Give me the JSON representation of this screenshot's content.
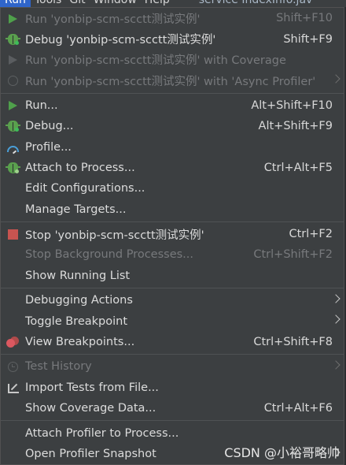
{
  "menubar": {
    "items": [
      "Run",
      "Tools",
      "Git",
      "Window",
      "Help"
    ],
    "file": "service   IndexInfo.jav"
  },
  "menu": {
    "groups": [
      [
        {
          "label": "Run 'yonbip-scm-scctt测试实例'",
          "shortcut": "Shift+F10",
          "icon": "play-icon",
          "disabled": true
        },
        {
          "label": "Debug 'yonbip-scm-scctt测试实例'",
          "shortcut": "Shift+F9",
          "icon": "debug-bug-icon",
          "disabled": false
        },
        {
          "label": "Run 'yonbip-scm-scctt测试实例' with Coverage",
          "shortcut": "",
          "icon": "coverage-icon",
          "disabled": true
        },
        {
          "label": "Run 'yonbip-scm-scctt测试实例' with 'Async Profiler'",
          "shortcut": "",
          "icon": "async-profiler-icon",
          "disabled": true,
          "submenu": true
        }
      ],
      [
        {
          "label": "Run...",
          "shortcut": "Alt+Shift+F10",
          "icon": "play-icon",
          "disabled": false
        },
        {
          "label": "Debug...",
          "shortcut": "Alt+Shift+F9",
          "icon": "debug-bug-icon",
          "disabled": false
        },
        {
          "label": "Profile...",
          "shortcut": "",
          "icon": "profile-gauge-icon",
          "disabled": false
        },
        {
          "label": "Attach to Process...",
          "shortcut": "Ctrl+Alt+F5",
          "icon": "attach-bug-icon",
          "disabled": false
        },
        {
          "label": "Edit Configurations...",
          "shortcut": "",
          "icon": "",
          "disabled": false
        },
        {
          "label": "Manage Targets...",
          "shortcut": "",
          "icon": "",
          "disabled": false
        }
      ],
      [
        {
          "label": "Stop 'yonbip-scm-scctt测试实例'",
          "shortcut": "Ctrl+F2",
          "icon": "stop-icon",
          "disabled": false
        },
        {
          "label": "Stop Background Processes...",
          "shortcut": "Ctrl+Shift+F2",
          "icon": "",
          "disabled": true
        },
        {
          "label": "Show Running List",
          "shortcut": "",
          "icon": "",
          "disabled": false
        }
      ],
      [
        {
          "label": "Debugging Actions",
          "shortcut": "",
          "icon": "",
          "disabled": false,
          "submenu": true
        },
        {
          "label": "Toggle Breakpoint",
          "shortcut": "",
          "icon": "",
          "disabled": false,
          "submenu": true
        },
        {
          "label": "View Breakpoints...",
          "shortcut": "Ctrl+Shift+F8",
          "icon": "breakpoints-icon",
          "disabled": false
        }
      ],
      [
        {
          "label": "Test History",
          "shortcut": "",
          "icon": "test-history-clock-icon",
          "disabled": true,
          "submenu": true
        },
        {
          "label": "Import Tests from File...",
          "shortcut": "",
          "icon": "import-tests-icon",
          "disabled": false
        },
        {
          "label": "Show Coverage Data...",
          "shortcut": "Ctrl+Alt+F6",
          "icon": "",
          "disabled": false
        }
      ],
      [
        {
          "label": "Attach Profiler to Process...",
          "shortcut": "",
          "icon": "",
          "disabled": false
        },
        {
          "label": "Open Profiler Snapshot",
          "shortcut": "",
          "icon": "",
          "disabled": false,
          "submenu": true
        }
      ]
    ]
  },
  "watermark": "CSDN @小裕哥略帅"
}
